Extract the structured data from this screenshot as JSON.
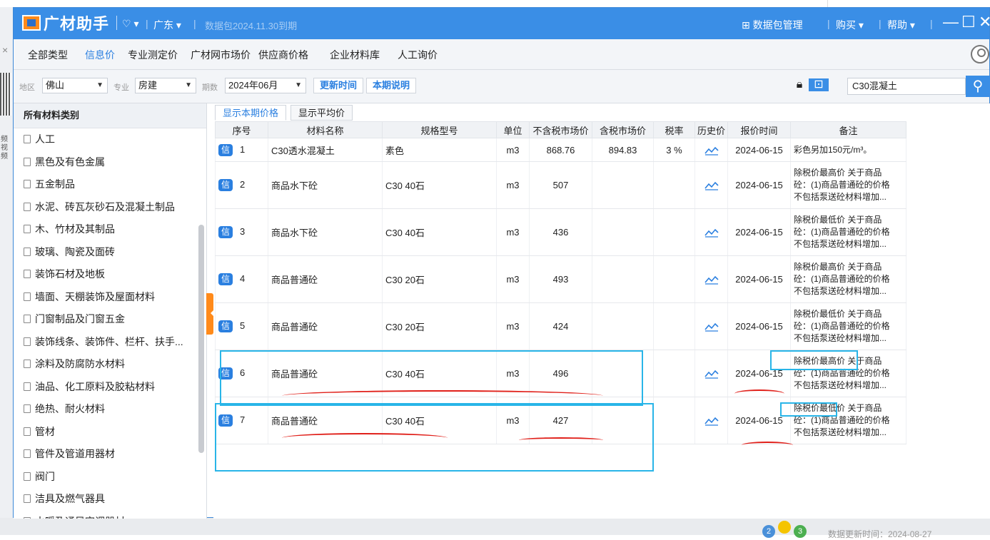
{
  "app": {
    "logo": "广材助手",
    "region": "广东",
    "package_expiry": "数据包2024.11.30到期",
    "package_manage": "数据包管理",
    "buy": "购买",
    "help": "帮助"
  },
  "type_tabs": [
    "全部类型",
    "信息价",
    "专业测定价",
    "广材网市场价",
    "供应商价格",
    "企业材料库",
    "人工询价"
  ],
  "active_type_tab": "信息价",
  "filters": {
    "region_label": "地区",
    "region_value": "佛山",
    "specialty_label": "专业",
    "specialty_value": "房建",
    "period_label": "期数",
    "period_value": "2024年06月",
    "update_time_button": "更新时间",
    "period_note_button": "本期说明",
    "search_value": "C30混凝土"
  },
  "sidebar": {
    "title": "所有材料类别",
    "items": [
      "人工",
      "黑色及有色金属",
      "五金制品",
      "水泥、砖瓦灰砂石及混凝土制品",
      "木、竹材及其制品",
      "玻璃、陶瓷及面砖",
      "装饰石材及地板",
      "墙面、天棚装饰及屋面材料",
      "门窗制品及门窗五金",
      "装饰线条、装饰件、栏杆、扶手...",
      "涂料及防腐防水材料",
      "油品、化工原料及胶粘材料",
      "绝热、耐火材料",
      "管材",
      "管件及管道用器材",
      "阀门",
      "洁具及燃气器具",
      "水暖及通风空调器材"
    ]
  },
  "subtabs": [
    "显示本期价格",
    "显示平均价"
  ],
  "table": {
    "headers": [
      "序号",
      "材料名称",
      "规格型号",
      "单位",
      "不含税市场价",
      "含税市场价",
      "税率",
      "历史价",
      "报价时间",
      "备注"
    ],
    "badge": "信",
    "rows": [
      {
        "no": "1",
        "name": "C30透水混凝土",
        "spec": "素色",
        "unit": "m3",
        "price_ex": "868.76",
        "price_in": "894.83",
        "tax": "3 %",
        "date": "2024-06-15",
        "note_1": "彩色另加150元/m³。",
        "note_2": "",
        "note_3": ""
      },
      {
        "no": "2",
        "name": "商品水下砼",
        "spec": "C30 40石",
        "unit": "m3",
        "price_ex": "507",
        "price_in": "",
        "tax": "",
        "date": "2024-06-15",
        "note_1": "除税价最高价 关于商品",
        "note_2": "砼：(1)商品普通砼的价格",
        "note_3": "不包括泵送砼材料增加..."
      },
      {
        "no": "3",
        "name": "商品水下砼",
        "spec": "C30 40石",
        "unit": "m3",
        "price_ex": "436",
        "price_in": "",
        "tax": "",
        "date": "2024-06-15",
        "note_1": "除税价最低价 关于商品",
        "note_2": "砼：(1)商品普通砼的价格",
        "note_3": "不包括泵送砼材料增加..."
      },
      {
        "no": "4",
        "name": "商品普通砼",
        "spec": "C30 20石",
        "unit": "m3",
        "price_ex": "493",
        "price_in": "",
        "tax": "",
        "date": "2024-06-15",
        "note_1": "除税价最高价 关于商品",
        "note_2": "砼：(1)商品普通砼的价格",
        "note_3": "不包括泵送砼材料增加..."
      },
      {
        "no": "5",
        "name": "商品普通砼",
        "spec": "C30 20石",
        "unit": "m3",
        "price_ex": "424",
        "price_in": "",
        "tax": "",
        "date": "2024-06-15",
        "note_1": "除税价最低价 关于商品",
        "note_2": "砼：(1)商品普通砼的价格",
        "note_3": "不包括泵送砼材料增加..."
      },
      {
        "no": "6",
        "name": "商品普通砼",
        "spec": "C30 40石",
        "unit": "m3",
        "price_ex": "496",
        "price_in": "",
        "tax": "",
        "date": "2024-06-15",
        "note_1": "除税价最高价 关于商品",
        "note_2": "砼：(1)商品普通砼的价格",
        "note_3": "不包括泵送砼材料增加..."
      },
      {
        "no": "7",
        "name": "商品普通砼",
        "spec": "C30 40石",
        "unit": "m3",
        "price_ex": "427",
        "price_in": "",
        "tax": "",
        "date": "2024-06-15",
        "note_1": "除税价最低价 关于商品",
        "note_2": "砼：(1)商品普通砼的价格",
        "note_3": "不包括泵送砼材料增加..."
      }
    ]
  },
  "background": {
    "side_text": "频视频",
    "footer_stamp": "数据更新时间：2024-08-27",
    "badges": [
      "2",
      "",
      "3"
    ]
  },
  "colors": {
    "titlebar": "#3a8ee6",
    "accent": "#2a7fe0",
    "orange": "#ff8a1a",
    "annotation_box": "#29b5e8",
    "annotation_underline": "#e0201a"
  }
}
